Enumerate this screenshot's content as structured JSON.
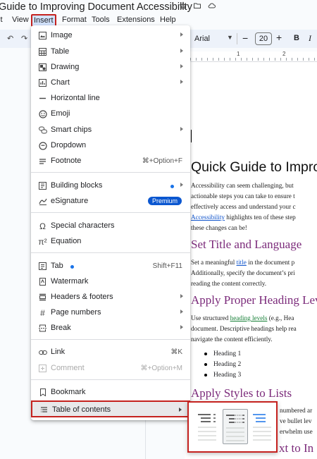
{
  "document": {
    "title": "Guide to Improving Document Accessibility",
    "heading_main": "Quick Guide to Improv",
    "intro_lines": [
      "Accessibility can seem challenging, but",
      "actionable steps you can take to ensure t",
      "effectively access and understand your c"
    ],
    "intro_link": "Accessibility",
    "intro_link_rest": " highlights ten of these step",
    "intro_last": "these changes can be!",
    "section1_heading": "Set Title and Language",
    "section1_line1_pre": "Set a meaningful ",
    "section1_line1_link": "title",
    "section1_line1_post": " in the document p",
    "section1_line2": "Additionally, specify the document’s pri",
    "section1_line3": "reading the content correctly.",
    "section2_heading": "Apply Proper Heading Lev",
    "section2_line1_pre": "Use structured ",
    "section2_line1_link": "heading levels",
    "section2_line1_post": " (e.g., Hea",
    "section2_line2": "document. Descriptive headings help rea",
    "section2_line3": "navigate the content efficiently.",
    "bullets": [
      "Heading 1",
      "Heading 2",
      "Heading 3"
    ],
    "section3_heading": "Apply Styles to Lists",
    "section3_frag1": "numbered ar",
    "section3_frag2": "ve bullet lev",
    "section3_frag3": "erwhelm use",
    "section4_frag": "xt to In"
  },
  "menubar": {
    "items": [
      "it",
      "View",
      "Insert",
      "Format",
      "Tools",
      "Extensions",
      "Help"
    ],
    "active": "Insert"
  },
  "toolbar": {
    "font": "Arial",
    "font_size": "20",
    "minus": "−",
    "plus": "+",
    "bold": "B",
    "italic": "I"
  },
  "ruler": {
    "marks": [
      "1",
      "2"
    ]
  },
  "insert_menu": {
    "items": [
      {
        "label": "Image",
        "icon": "image-icon",
        "submenu": true
      },
      {
        "label": "Table",
        "icon": "table-icon",
        "submenu": true
      },
      {
        "label": "Drawing",
        "icon": "drawing-icon",
        "submenu": true
      },
      {
        "label": "Chart",
        "icon": "chart-icon",
        "submenu": true
      },
      {
        "label": "Horizontal line",
        "icon": "horizontal-line-icon"
      },
      {
        "label": "Emoji",
        "icon": "emoji-icon"
      },
      {
        "label": "Smart chips",
        "icon": "smart-chips-icon",
        "submenu": true
      },
      {
        "label": "Dropdown",
        "icon": "dropdown-icon"
      },
      {
        "label": "Footnote",
        "icon": "footnote-icon",
        "shortcut": "⌘+Option+F"
      },
      {
        "label": "Building blocks",
        "icon": "building-blocks-icon",
        "submenu": true
      },
      {
        "label": "eSignature",
        "icon": "esignature-icon",
        "badge": "Premium"
      },
      {
        "label": "Special characters",
        "icon": "omega-icon"
      },
      {
        "label": "Equation",
        "icon": "pi-icon"
      },
      {
        "label": "Tab",
        "icon": "tab-icon",
        "shortcut": "Shift+F11"
      },
      {
        "label": "Watermark",
        "icon": "watermark-icon"
      },
      {
        "label": "Headers & footers",
        "icon": "headers-footers-icon",
        "submenu": true
      },
      {
        "label": "Page numbers",
        "icon": "hash-icon",
        "submenu": true
      },
      {
        "label": "Break",
        "icon": "break-icon",
        "submenu": true
      },
      {
        "label": "Link",
        "icon": "link-icon",
        "shortcut": "⌘K"
      },
      {
        "label": "Comment",
        "icon": "comment-icon",
        "shortcut": "⌘+Option+M",
        "disabled": true
      },
      {
        "label": "Bookmark",
        "icon": "bookmark-icon"
      },
      {
        "label": "Table of contents",
        "icon": "toc-icon",
        "submenu": true,
        "highlighted": true
      }
    ]
  },
  "colors": {
    "highlight_border": "#c5221f",
    "heading": "#7b2a7a",
    "link": "#1155cc",
    "accent": "#0b57d0"
  }
}
